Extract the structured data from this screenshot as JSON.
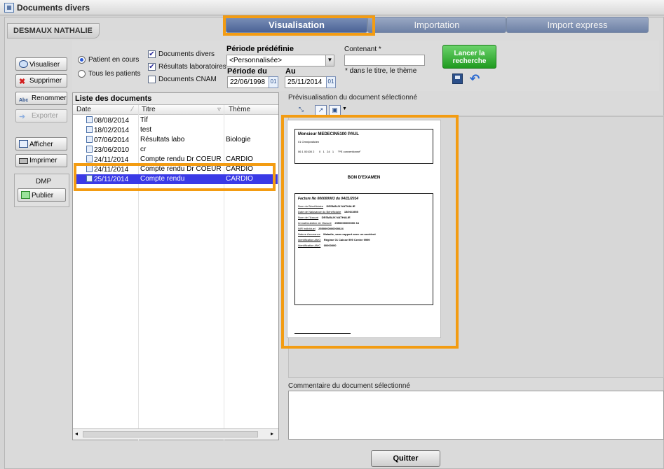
{
  "window": {
    "title": "Documents divers"
  },
  "patient": {
    "name": "DESMAUX NATHALIE"
  },
  "tabs": [
    {
      "label": "Visualisation"
    },
    {
      "label": "Importation"
    },
    {
      "label": "Import express"
    }
  ],
  "sidebar": {
    "visualiser": "Visualiser",
    "supprimer": "Supprimer",
    "renommer": "Renommer",
    "exporter": "Exporter",
    "afficher": "Afficher",
    "imprimer": "Imprimer",
    "dmp_label": "DMP",
    "publier": "Publier"
  },
  "filters": {
    "patient_en_cours": "Patient en cours",
    "tous_les_patients": "Tous les patients",
    "documents_divers": "Documents divers",
    "resultats": "Résultats laboratoires",
    "documents_cnam": "Documents CNAM",
    "periode_predefinie_label": "Période prédéfinie",
    "periode_predefinie_value": "<Personnalisée>",
    "periode_du_label": "Période du",
    "periode_du_value": "22/06/1998",
    "au_label": "Au",
    "au_value": "25/11/2014",
    "contenant_label": "Contenant *",
    "contenant_value": "",
    "contenant_hint": "* dans le titre, le thème",
    "lancer_line1": "Lancer la",
    "lancer_line2": "recherche"
  },
  "list": {
    "title": "Liste des documents",
    "columns": [
      "Date",
      "Titre",
      "Thème"
    ],
    "rows": [
      {
        "date": "08/08/2014",
        "titre": "Tif",
        "theme": ""
      },
      {
        "date": "18/02/2014",
        "titre": "test",
        "theme": ""
      },
      {
        "date": "07/06/2014",
        "titre": "Résultats labo",
        "theme": "Biologie"
      },
      {
        "date": "23/06/2010",
        "titre": "cr",
        "theme": ""
      },
      {
        "date": "24/11/2014",
        "titre": "Compte rendu Dr COEUR",
        "theme": "CARDIO"
      },
      {
        "date": "24/11/2014",
        "titre": "Compte rendu Dr COEUR",
        "theme": "CARDIO"
      },
      {
        "date": "25/11/2014",
        "titre": "Compte rendu",
        "theme": "CARDIO"
      }
    ],
    "selected_index": 6
  },
  "preview": {
    "label": "Prévisualisation du document sélectionné",
    "doc_header": "Monsieur MEDECIN5100 PAUL",
    "doc_sub": "01 Omnipraticien",
    "doc_codes": "06 1 00100 2      0   1   24   1     \"PE conventionné\"",
    "doc_title": "BON D'EXAMEN",
    "doc_facture": "Facture No 000000003 du 04/11/2014",
    "doc_fields": [
      {
        "k": "Nom du Bénéficiaire",
        "v": "DESMAUX NATHALIE"
      },
      {
        "k": "Date de Naissance du Bénéficiaire",
        "v": "15/06/1955"
      },
      {
        "k": "Nom de l'Assuré",
        "v": "DESMAUX NATHALIE"
      },
      {
        "k": "Immatriculation de l'Assuré",
        "v": "2550000000000 34"
      },
      {
        "k": "NIR individuel",
        "v": "2550000000000024"
      },
      {
        "k": "Nature Assurance",
        "v": "Maladie, sans rapport avec un accident"
      },
      {
        "k": "Identification AMO",
        "v": "Régime 01   Caisse 999   Centre 9999"
      },
      {
        "k": "Identification AMC",
        "v": "00000000"
      }
    ]
  },
  "comment": {
    "label": "Commentaire du document sélectionné"
  },
  "footer": {
    "quit": "Quitter"
  }
}
